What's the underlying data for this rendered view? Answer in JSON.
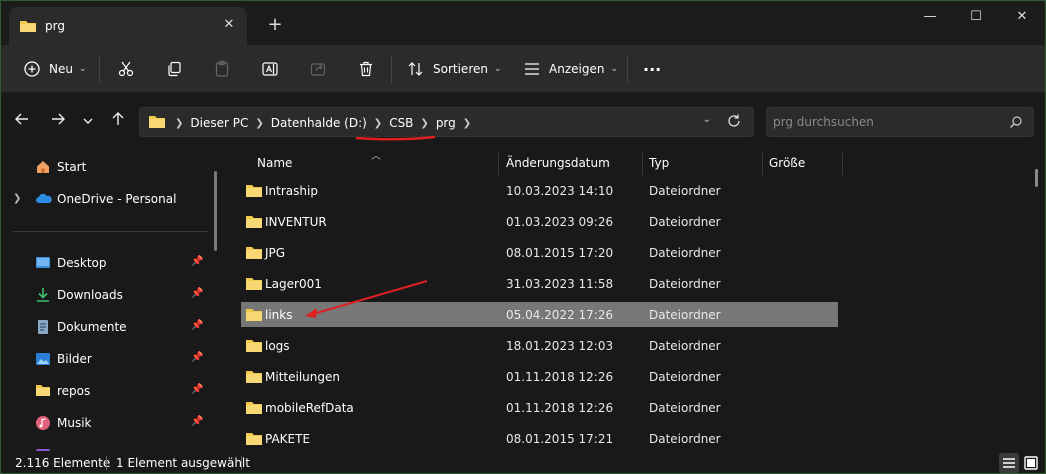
{
  "window": {
    "tab_title": "prg",
    "new_tab_symbol": "+",
    "controls": {
      "minimize": "—",
      "maximize": "☐",
      "close": "✕"
    }
  },
  "commandbar": {
    "new_label": "Neu",
    "sort_label": "Sortieren",
    "view_label": "Anzeigen",
    "more_label": "···"
  },
  "address": {
    "crumbs": [
      "Dieser PC",
      "Datenhalde (D:)",
      "CSB",
      "prg"
    ],
    "search_placeholder": "prg durchsuchen"
  },
  "sidebar": {
    "items": [
      {
        "label": "Start",
        "icon": "home-icon"
      },
      {
        "label": "OneDrive - Personal",
        "icon": "cloud-icon"
      },
      {
        "label": "Desktop",
        "icon": "desktop-icon",
        "pinned": true
      },
      {
        "label": "Downloads",
        "icon": "download-icon",
        "pinned": true
      },
      {
        "label": "Dokumente",
        "icon": "document-icon",
        "pinned": true
      },
      {
        "label": "Bilder",
        "icon": "picture-icon",
        "pinned": true
      },
      {
        "label": "repos",
        "icon": "folder-icon",
        "pinned": true
      },
      {
        "label": "Musik",
        "icon": "music-icon",
        "pinned": true
      }
    ]
  },
  "columns": {
    "name": "Name",
    "date": "Änderungsdatum",
    "type": "Typ",
    "size": "Größe"
  },
  "files": [
    {
      "name": "Intraship",
      "date": "10.03.2023 14:10",
      "type": "Dateiordner"
    },
    {
      "name": "INVENTUR",
      "date": "01.03.2023 09:26",
      "type": "Dateiordner"
    },
    {
      "name": "JPG",
      "date": "08.01.2015 17:20",
      "type": "Dateiordner"
    },
    {
      "name": "Lager001",
      "date": "31.03.2023 11:58",
      "type": "Dateiordner"
    },
    {
      "name": "links",
      "date": "05.04.2022 17:26",
      "type": "Dateiordner",
      "selected": true
    },
    {
      "name": "logs",
      "date": "18.01.2023 12:03",
      "type": "Dateiordner"
    },
    {
      "name": "Mitteilungen",
      "date": "01.11.2018 12:26",
      "type": "Dateiordner"
    },
    {
      "name": "mobileRefData",
      "date": "01.11.2018 12:26",
      "type": "Dateiordner"
    },
    {
      "name": "PAKETE",
      "date": "08.01.2015 17:21",
      "type": "Dateiordner"
    }
  ],
  "status": {
    "count": "2.116 Elemente",
    "selection": "1 Element ausgewählt"
  },
  "colors": {
    "background": "#191919",
    "toolbar": "#2b2b2b",
    "selected_row": "#777777",
    "folder": "#f2c94c",
    "annotation": "#e02020",
    "accent": "#4aa3ff"
  }
}
